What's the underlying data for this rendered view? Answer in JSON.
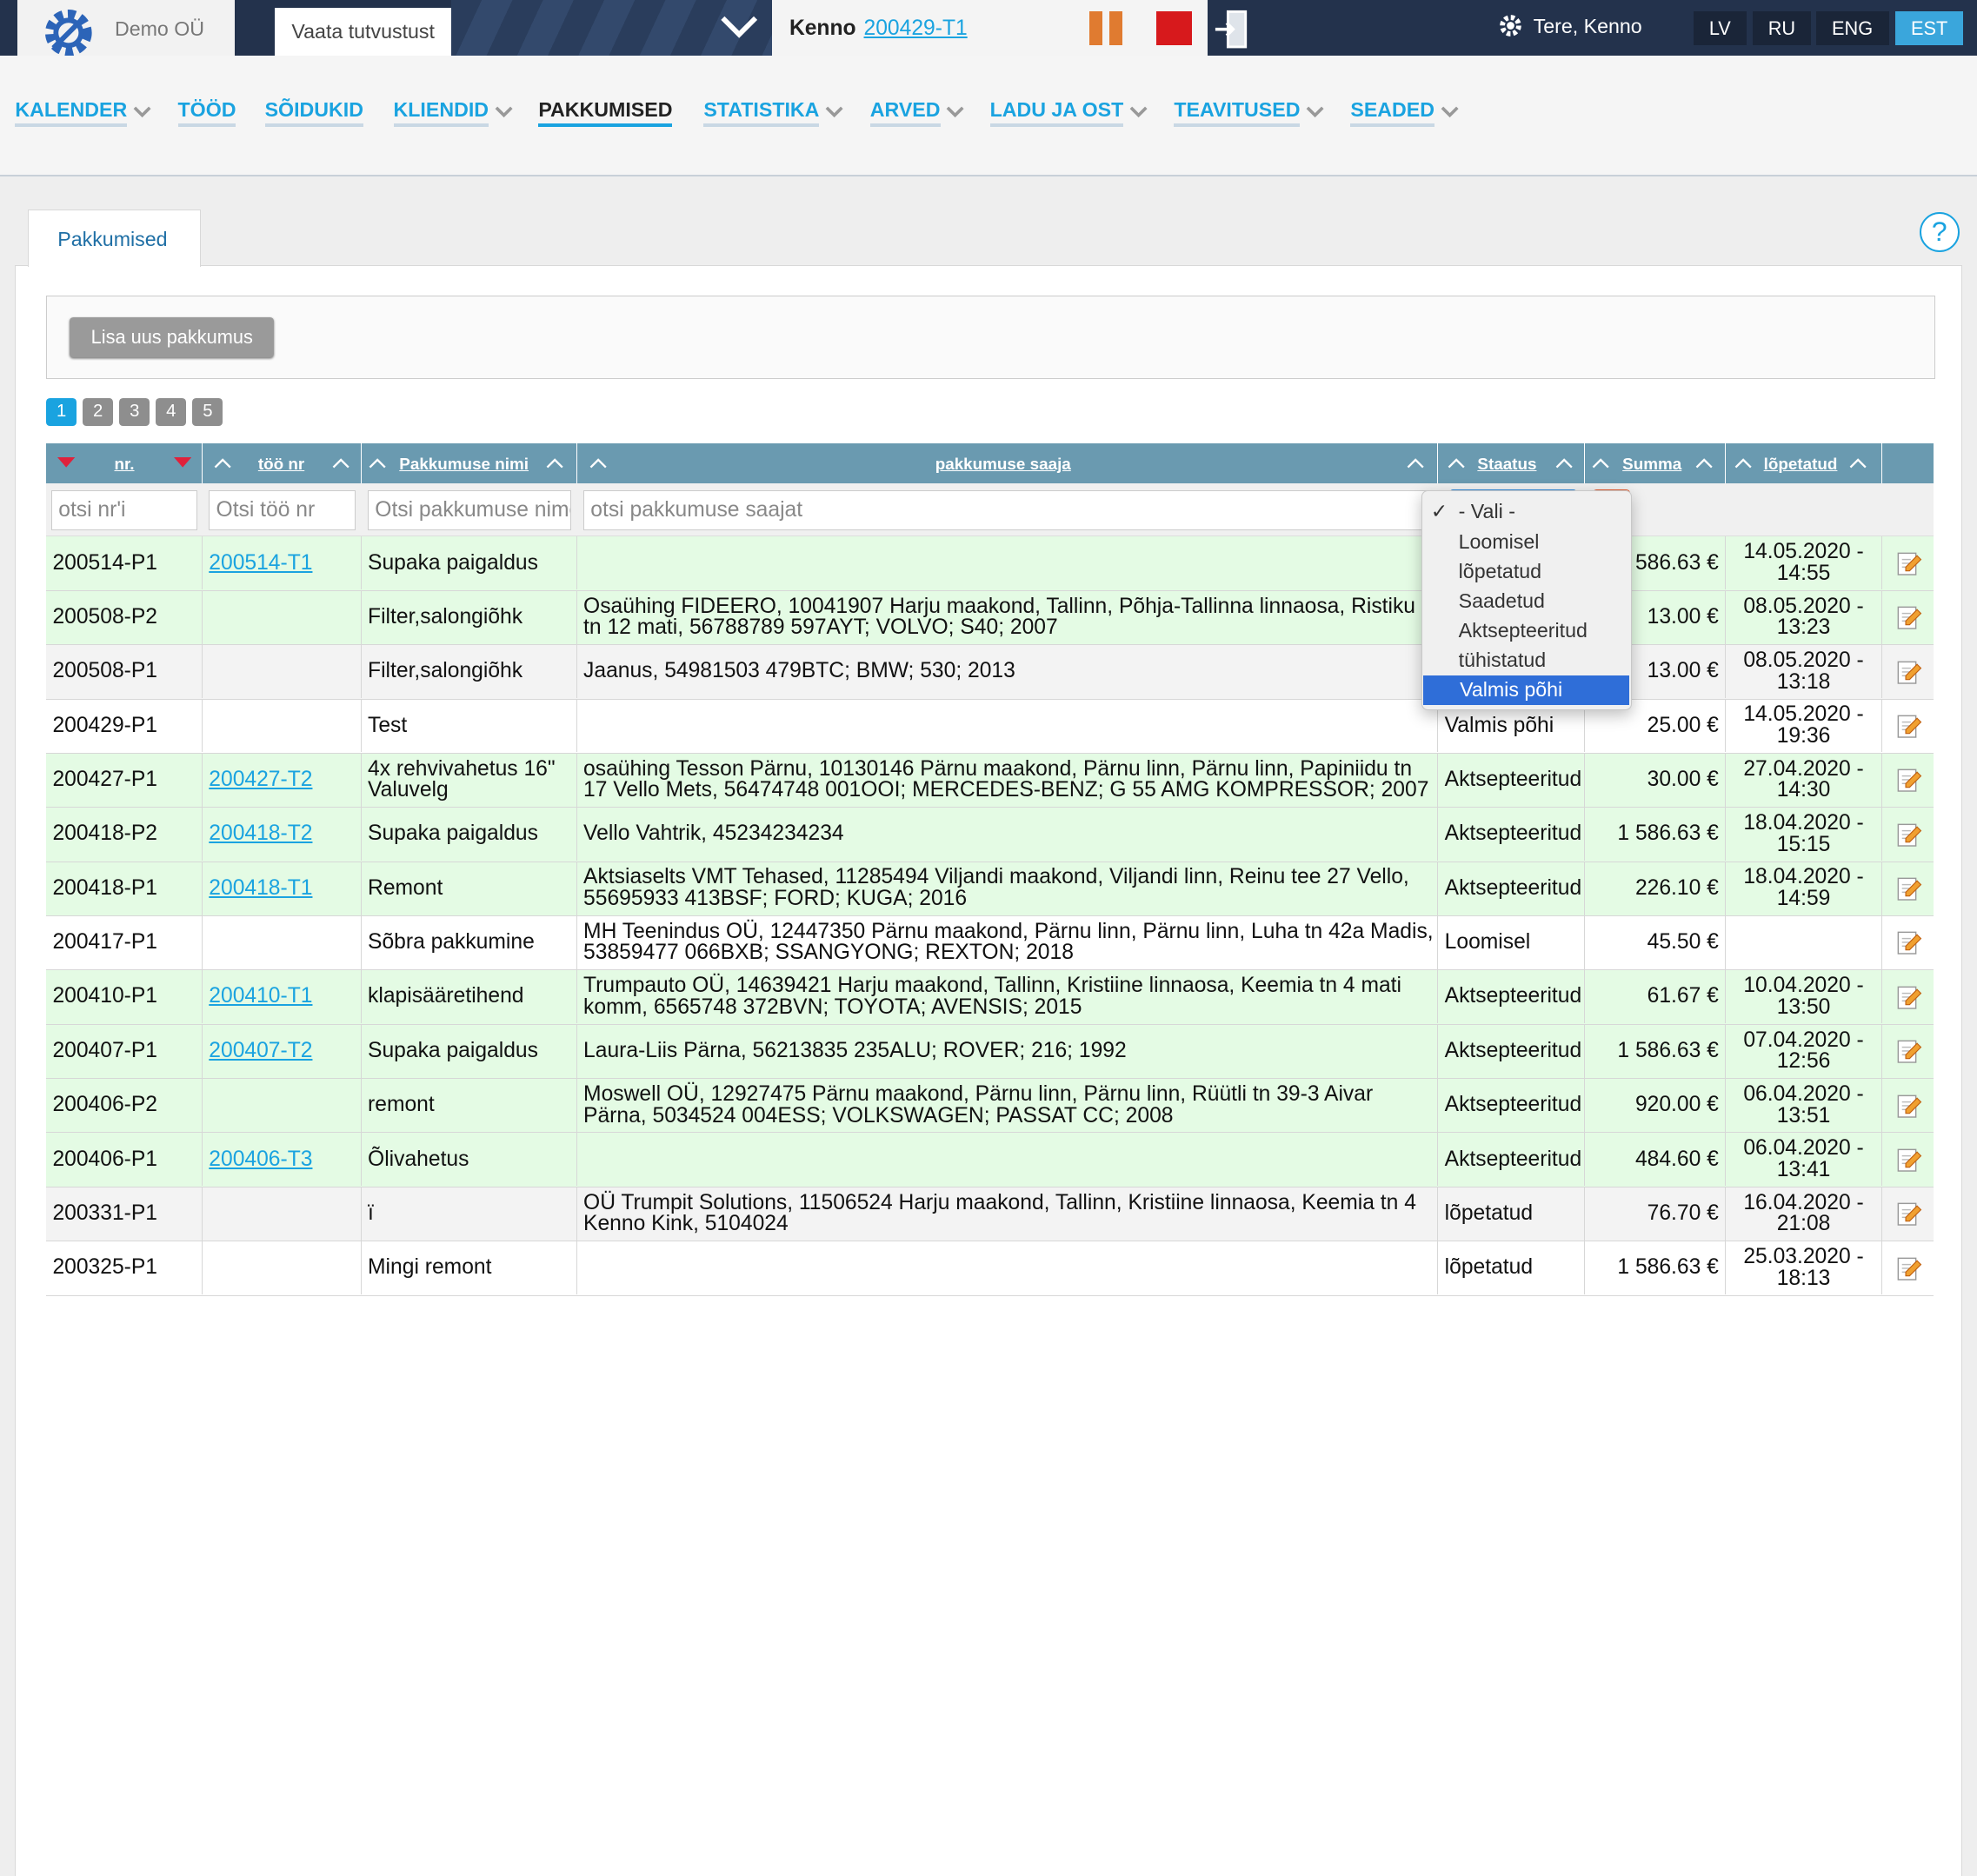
{
  "topbar": {
    "company": "Demo OÜ",
    "demo_tab": "Vaata tutvustust",
    "kenno_label": "Kenno",
    "kenno_link": "200429-T1",
    "greeting": "Tere, Kenno",
    "languages": [
      "LV",
      "RU",
      "ENG",
      "EST"
    ],
    "active_language": "EST"
  },
  "nav": {
    "items": [
      "KALENDER",
      "TÖÖD",
      "SÕIDUKID",
      "KLIENDID",
      "PAKKUMISED",
      "STATISTIKA",
      "ARVED",
      "LADU JA OST",
      "TEAVITUSED",
      "SEADED"
    ],
    "active": "PAKKUMISED"
  },
  "tab": "Pakkumised",
  "help": "?",
  "add_button": "Lisa uus pakkumus",
  "pagination": [
    "1",
    "2",
    "3",
    "4",
    "5"
  ],
  "table": {
    "headers": [
      "nr.",
      "töö nr",
      "Pakkumuse nimi",
      "pakkumuse saaja",
      "Staatus",
      "Summa",
      "lõpetatud"
    ],
    "filters": {
      "nr": "otsi nr'i",
      "too": "Otsi töö nr",
      "nimi": "Otsi pakkumuse nime",
      "saaja": "otsi pakkumuse saajat"
    },
    "rows": [
      {
        "nr": "200514-P1",
        "too": "200514-T1",
        "nimi": "Supaka paigaldus",
        "saaja": "",
        "staatus": "",
        "summa": "586.63 €",
        "lopetatud": "14.05.2020 - 14:55",
        "green": true
      },
      {
        "nr": "200508-P2",
        "too": "",
        "nimi": "Filter,salongiõhk",
        "saaja": "Osaühing FIDEERO, 10041907 Harju maakond, Tallinn, Põhja-Tallinna linnaosa, Ristiku tn 12 mati, 56788789 597AYT; VOLVO; S40; 2007",
        "staatus": "",
        "summa": "13.00 €",
        "lopetatud": "08.05.2020 - 13:23",
        "green": true
      },
      {
        "nr": "200508-P1",
        "too": "",
        "nimi": "Filter,salongiõhk",
        "saaja": "Jaanus, 54981503 479BTC; BMW; 530; 2013",
        "staatus": "",
        "summa": "13.00 €",
        "lopetatud": "08.05.2020 - 13:18",
        "green": false
      },
      {
        "nr": "200429-P1",
        "too": "",
        "nimi": "Test",
        "saaja": "",
        "staatus": "Valmis põhi",
        "summa": "25.00 €",
        "lopetatud": "14.05.2020 - 19:36",
        "green": false
      },
      {
        "nr": "200427-P1",
        "too": "200427-T2",
        "nimi": "4x rehvivahetus 16\" Valuvelg",
        "saaja": "osaühing Tesson Pärnu, 10130146 Pärnu maakond, Pärnu linn, Pärnu linn, Papiniidu tn 17 Vello Mets, 56474748 001OOI; MERCEDES-BENZ; G 55 AMG KOMPRESSOR; 2007",
        "staatus": "Aktsepteeritud",
        "summa": "30.00 €",
        "lopetatud": "27.04.2020 - 14:30",
        "green": true
      },
      {
        "nr": "200418-P2",
        "too": "200418-T2",
        "nimi": "Supaka paigaldus",
        "saaja": "Vello Vahtrik, 45234234234",
        "staatus": "Aktsepteeritud",
        "summa": "1 586.63 €",
        "lopetatud": "18.04.2020 - 15:15",
        "green": true
      },
      {
        "nr": "200418-P1",
        "too": "200418-T1",
        "nimi": "Remont",
        "saaja": "Aktsiaselts VMT Tehased, 11285494 Viljandi maakond, Viljandi linn, Reinu tee 27 Vello, 55695933 413BSF; FORD; KUGA; 2016",
        "staatus": "Aktsepteeritud",
        "summa": "226.10 €",
        "lopetatud": "18.04.2020 - 14:59",
        "green": true
      },
      {
        "nr": "200417-P1",
        "too": "",
        "nimi": "Sõbra pakkumine",
        "saaja": "MH Teenindus OÜ, 12447350 Pärnu maakond, Pärnu linn, Pärnu linn, Luha tn 42a Madis, 53859477 066BXB; SSANGYONG; REXTON; 2018",
        "staatus": "Loomisel",
        "summa": "45.50 €",
        "lopetatud": "",
        "green": false
      },
      {
        "nr": "200410-P1",
        "too": "200410-T1",
        "nimi": "klapisääretihend",
        "saaja": "Trumpauto OÜ, 14639421 Harju maakond, Tallinn, Kristiine linnaosa, Keemia tn 4 mati komm, 6565748 372BVN; TOYOTA; AVENSIS; 2015",
        "staatus": "Aktsepteeritud",
        "summa": "61.67 €",
        "lopetatud": "10.04.2020 - 13:50",
        "green": true
      },
      {
        "nr": "200407-P1",
        "too": "200407-T2",
        "nimi": "Supaka paigaldus",
        "saaja": "Laura-Liis Pärna, 56213835 235ALU; ROVER; 216; 1992",
        "staatus": "Aktsepteeritud",
        "summa": "1 586.63 €",
        "lopetatud": "07.04.2020 - 12:56",
        "green": true
      },
      {
        "nr": "200406-P2",
        "too": "",
        "nimi": "remont",
        "saaja": "Moswell OÜ, 12927475 Pärnu maakond, Pärnu linn, Pärnu linn, Rüütli tn 39-3 Aivar Pärna, 5034524 004ESS; VOLKSWAGEN; PASSAT CC; 2008",
        "staatus": "Aktsepteeritud",
        "summa": "920.00 €",
        "lopetatud": "06.04.2020 - 13:51",
        "green": true
      },
      {
        "nr": "200406-P1",
        "too": "200406-T3",
        "nimi": "Õlivahetus",
        "saaja": "",
        "staatus": "Aktsepteeritud",
        "summa": "484.60 €",
        "lopetatud": "06.04.2020 - 13:41",
        "green": true
      },
      {
        "nr": "200331-P1",
        "too": "",
        "nimi": "ï",
        "saaja": "OÜ Trumpit Solutions, 11506524 Harju maakond, Tallinn, Kristiine linnaosa, Keemia tn 4 Kenno Kink, 5104024",
        "staatus": "lõpetatud",
        "summa": "76.70 €",
        "lopetatud": "16.04.2020 - 21:08",
        "green": false
      },
      {
        "nr": "200325-P1",
        "too": "",
        "nimi": "Mingi remont",
        "saaja": "",
        "staatus": "lõpetatud",
        "summa": "1 586.63 €",
        "lopetatud": "25.03.2020 - 18:13",
        "green": false
      }
    ]
  },
  "status_dropdown": {
    "options": [
      "- Vali -",
      "Loomisel",
      "lõpetatud",
      "Saadetud",
      "Aktsepteeritud",
      "tühistatud",
      "Valmis põhi"
    ],
    "checked": "- Vali -",
    "highlighted": "Valmis põhi"
  },
  "colors": {
    "topbar": "#23324c",
    "accent": "#1aa3e0",
    "header": "#6a9ab0",
    "row_green": "#e4fbe4",
    "row_grey": "#f3f3f3",
    "highlight": "#2f6ed8"
  },
  "icons": {
    "logo": "gear-logo-icon",
    "chevron": "chevron-down-icon",
    "pause": "pause-icon",
    "stop": "stop-icon",
    "exit": "exit-door-icon",
    "settings": "gear-icon",
    "help": "help-icon",
    "edit": "edit-document-icon",
    "sort_asc": "sort-up-icon",
    "sort_desc": "sort-down-icon"
  }
}
